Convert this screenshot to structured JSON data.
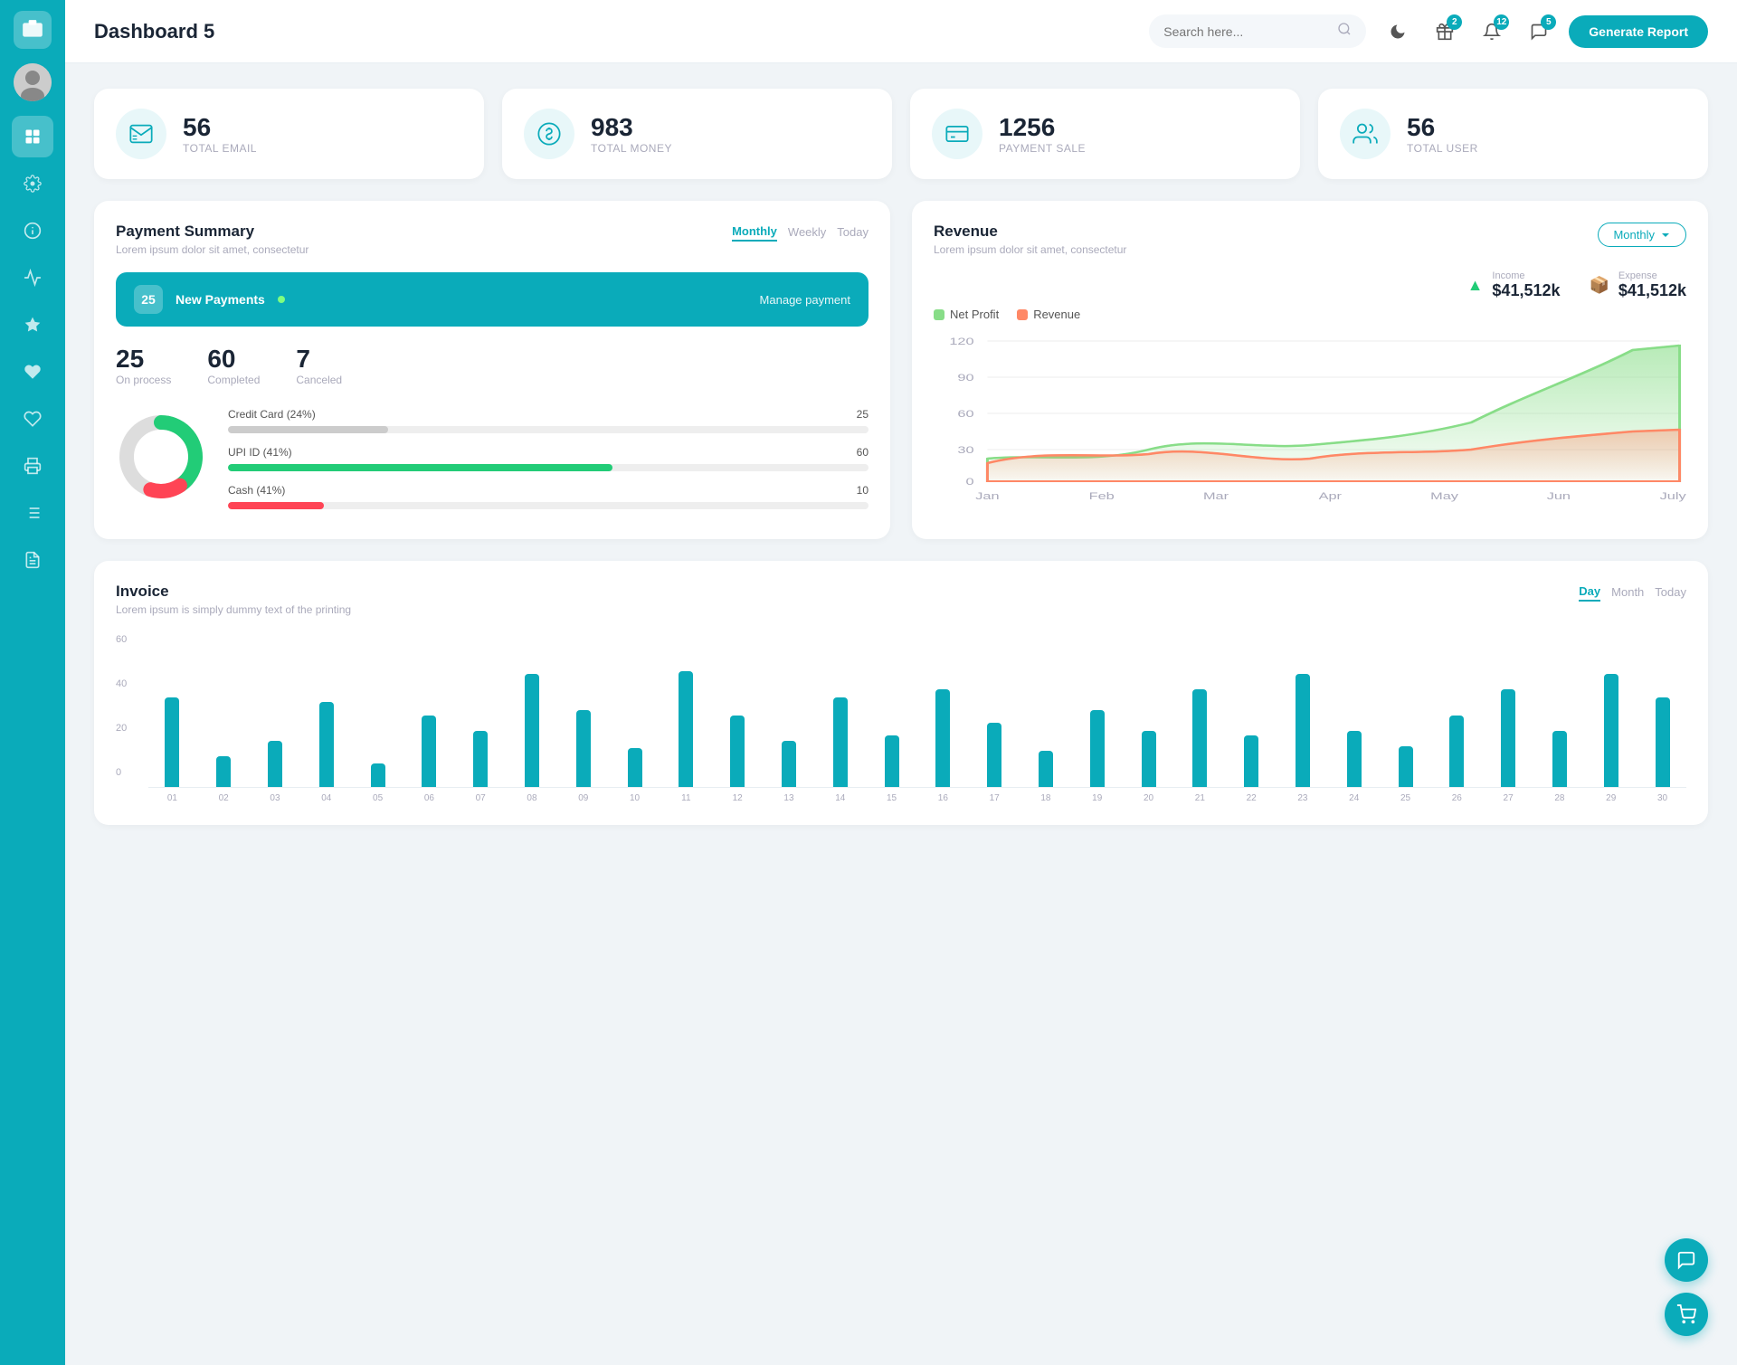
{
  "sidebar": {
    "logo_icon": "💼",
    "avatar_icon": "👤",
    "items": [
      {
        "id": "dashboard",
        "icon": "⊞",
        "active": true
      },
      {
        "id": "settings",
        "icon": "⚙"
      },
      {
        "id": "info",
        "icon": "ℹ"
      },
      {
        "id": "chart",
        "icon": "📊"
      },
      {
        "id": "star",
        "icon": "★"
      },
      {
        "id": "heart",
        "icon": "♥"
      },
      {
        "id": "heart2",
        "icon": "♡"
      },
      {
        "id": "print",
        "icon": "🖨"
      },
      {
        "id": "list",
        "icon": "☰"
      },
      {
        "id": "doc",
        "icon": "📋"
      }
    ]
  },
  "topbar": {
    "title": "Dashboard 5",
    "search_placeholder": "Search here...",
    "icons": {
      "moon": "🌙",
      "gift_badge": "2",
      "bell_badge": "12",
      "chat_badge": "5"
    },
    "generate_btn": "Generate Report"
  },
  "stat_cards": [
    {
      "id": "email",
      "icon": "📋",
      "number": "56",
      "label": "TOTAL EMAIL"
    },
    {
      "id": "money",
      "icon": "💲",
      "number": "983",
      "label": "TOTAL MONEY"
    },
    {
      "id": "payment",
      "icon": "💳",
      "number": "1256",
      "label": "PAYMENT SALE"
    },
    {
      "id": "user",
      "icon": "👥",
      "number": "56",
      "label": "TOTAL USER"
    }
  ],
  "payment_summary": {
    "title": "Payment Summary",
    "subtitle": "Lorem ipsum dolor sit amet, consectetur",
    "tabs": [
      "Monthly",
      "Weekly",
      "Today"
    ],
    "active_tab": "Monthly",
    "new_payments_count": "25",
    "new_payments_label": "New Payments",
    "manage_link": "Manage payment",
    "stats": [
      {
        "number": "25",
        "label": "On process"
      },
      {
        "number": "60",
        "label": "Completed"
      },
      {
        "number": "7",
        "label": "Canceled"
      }
    ],
    "progress_items": [
      {
        "label": "Credit Card (24%)",
        "value": 25,
        "max": 100,
        "color": "#ccc",
        "count": "25"
      },
      {
        "label": "UPI ID (41%)",
        "value": 60,
        "max": 100,
        "color": "#22cc77",
        "count": "60"
      },
      {
        "label": "Cash (41%)",
        "value": 10,
        "max": 100,
        "color": "#ff4455",
        "count": "10"
      }
    ],
    "donut": {
      "segments": [
        {
          "color": "#22cc77",
          "percent": 41
        },
        {
          "color": "#ff4455",
          "percent": 14
        },
        {
          "color": "#ddd",
          "percent": 45
        }
      ]
    }
  },
  "revenue": {
    "title": "Revenue",
    "subtitle": "Lorem ipsum dolor sit amet, consectetur",
    "dropdown": "Monthly",
    "legend": [
      {
        "label": "Net Profit",
        "color": "#88dd88"
      },
      {
        "label": "Revenue",
        "color": "#ff8866"
      }
    ],
    "income": {
      "label": "Income",
      "value": "$41,512k",
      "icon": "📈"
    },
    "expense": {
      "label": "Expense",
      "value": "$41,512k",
      "icon": "📦"
    },
    "x_labels": [
      "Jan",
      "Feb",
      "Mar",
      "Apr",
      "May",
      "Jun",
      "July"
    ],
    "y_labels": [
      "0",
      "30",
      "60",
      "90",
      "120"
    ]
  },
  "invoice": {
    "title": "Invoice",
    "subtitle": "Lorem ipsum is simply dummy text of the printing",
    "tabs": [
      "Day",
      "Month",
      "Today"
    ],
    "active_tab": "Day",
    "y_labels": [
      "0",
      "20",
      "40",
      "60"
    ],
    "x_labels": [
      "01",
      "02",
      "03",
      "04",
      "05",
      "06",
      "07",
      "08",
      "09",
      "10",
      "11",
      "12",
      "13",
      "14",
      "15",
      "16",
      "17",
      "18",
      "19",
      "20",
      "21",
      "22",
      "23",
      "24",
      "25",
      "26",
      "27",
      "28",
      "29",
      "30"
    ],
    "bars": [
      35,
      12,
      18,
      33,
      9,
      28,
      22,
      44,
      30,
      15,
      45,
      28,
      18,
      35,
      20,
      38,
      25,
      14,
      30,
      22,
      38,
      20,
      44,
      22,
      16,
      28,
      38,
      22,
      44,
      35
    ]
  },
  "colors": {
    "primary": "#0aabba",
    "success": "#22cc77",
    "danger": "#ff4455",
    "neutral": "#cccccc"
  }
}
